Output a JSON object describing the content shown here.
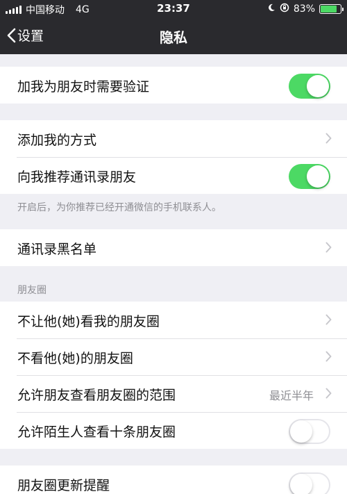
{
  "status_bar": {
    "carrier": "中国移动",
    "network": "4G",
    "time": "23:37",
    "battery": "83%",
    "battery_level": 0.83,
    "icons": [
      "signal-icon",
      "moon-icon",
      "rotation-lock-icon",
      "battery-icon"
    ]
  },
  "nav": {
    "back_label": "设置",
    "title": "隐私"
  },
  "groups": {
    "verify": {
      "label": "加我为朋友时需要验证",
      "on": true
    },
    "add_methods": {
      "label": "添加我的方式"
    },
    "recommend": {
      "label": "向我推荐通讯录朋友",
      "on": true,
      "footer": "开启后，为你推荐已经开通微信的手机联系人。"
    },
    "blacklist": {
      "label": "通讯录黑名单"
    },
    "moments": {
      "header": "朋友圈",
      "items": [
        {
          "label": "不让他(她)看我的朋友圈"
        },
        {
          "label": "不看他(她)的朋友圈"
        },
        {
          "label": "允许朋友查看朋友圈的范围",
          "value": "最近半年"
        },
        {
          "label": "允许陌生人查看十条朋友圈",
          "on": false
        }
      ]
    },
    "updates": {
      "label": "朋友圈更新提醒",
      "on": false
    }
  },
  "colors": {
    "toggle_on": "#4cd964",
    "nav_bg": "#2a2a2e",
    "page_bg": "#efeff4"
  }
}
